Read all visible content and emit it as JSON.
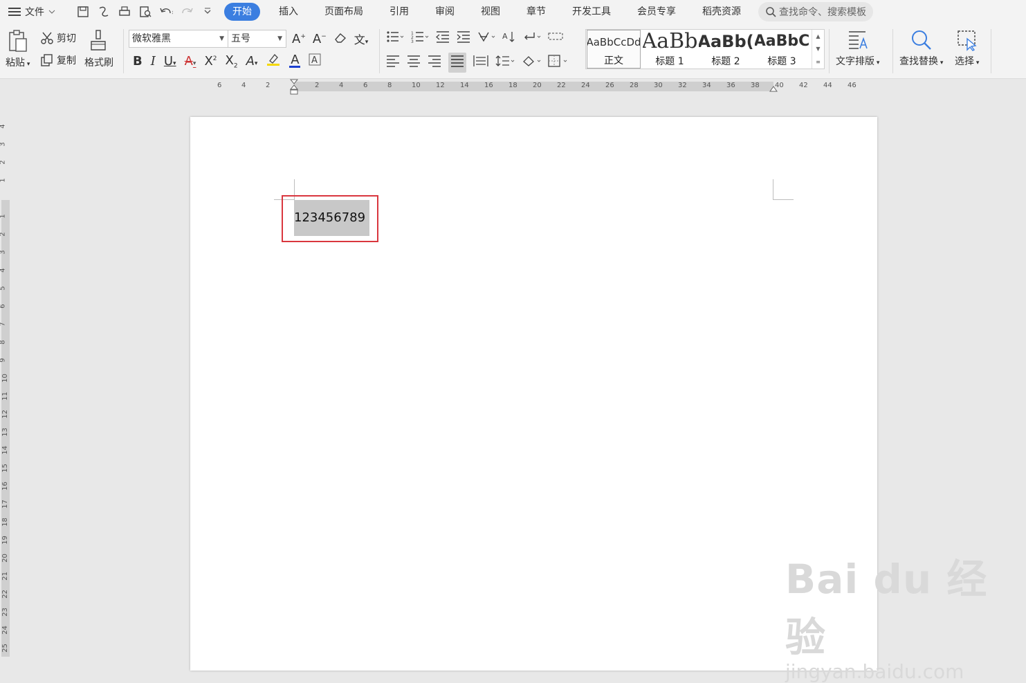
{
  "menu": {
    "file_label": "文件",
    "tabs": [
      {
        "label": "开始",
        "active": true
      },
      {
        "label": "插入"
      },
      {
        "label": "页面布局"
      },
      {
        "label": "引用"
      },
      {
        "label": "审阅"
      },
      {
        "label": "视图"
      },
      {
        "label": "章节"
      },
      {
        "label": "开发工具"
      },
      {
        "label": "会员专享"
      },
      {
        "label": "稻壳资源"
      }
    ],
    "search_placeholder": "查找命令、搜索模板"
  },
  "ribbon": {
    "paste_label": "粘贴",
    "cut_label": "剪切",
    "copy_label": "复制",
    "format_painter_label": "格式刷",
    "font_name": "微软雅黑",
    "font_size": "五号",
    "styles": [
      {
        "preview": "AaBbCcDd",
        "name": "正文"
      },
      {
        "preview": "AaBb",
        "name": "标题 1"
      },
      {
        "preview": "AaBb(",
        "name": "标题 2"
      },
      {
        "preview": "AaBbC",
        "name": "标题 3"
      }
    ],
    "text_layout_label": "文字排版",
    "find_replace_label": "查找替换",
    "select_label": "选择"
  },
  "ruler": {
    "horizontal": [
      "6",
      "4",
      "2",
      "2",
      "4",
      "6",
      "8",
      "10",
      "12",
      "14",
      "16",
      "18",
      "20",
      "22",
      "24",
      "26",
      "28",
      "30",
      "32",
      "34",
      "36",
      "38",
      "40",
      "42",
      "44",
      "46"
    ],
    "vertical": [
      "4",
      "3",
      "2",
      "1",
      "1",
      "2",
      "3",
      "4",
      "5",
      "6",
      "7",
      "8",
      "9",
      "10",
      "11",
      "12",
      "13",
      "14",
      "15",
      "16",
      "17",
      "18",
      "19",
      "20",
      "21",
      "22",
      "23",
      "24",
      "25"
    ]
  },
  "document": {
    "text": "123456789"
  },
  "watermark": {
    "brand": "Bai du 经验",
    "url": "jingyan.baidu.com"
  },
  "colors": {
    "accent": "#3b7ee0",
    "highlight_border": "#d9363e",
    "selection": "#c8c8c8"
  }
}
